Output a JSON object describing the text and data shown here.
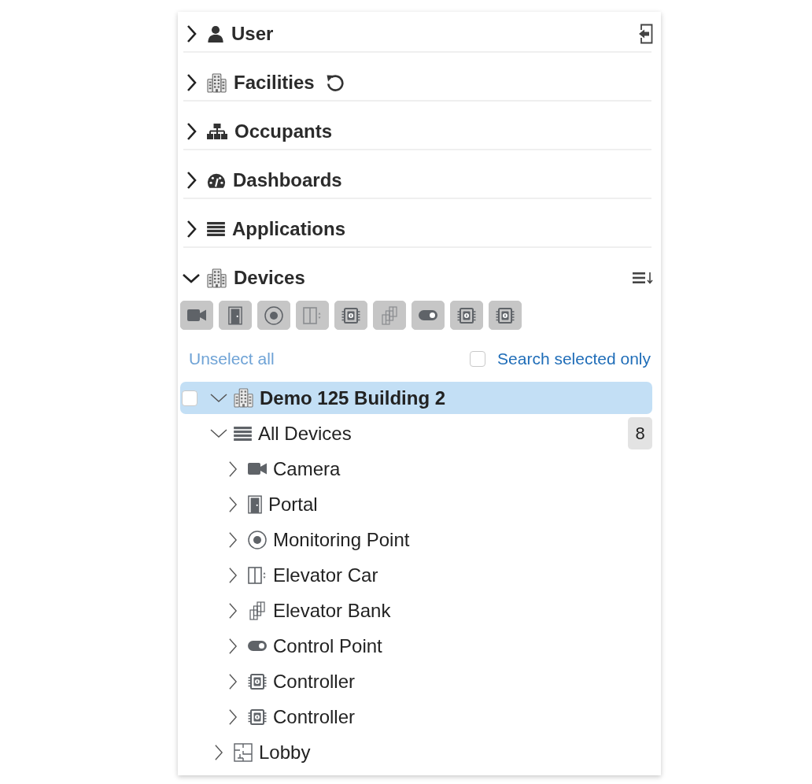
{
  "sections": [
    {
      "label": "User",
      "kind": "user",
      "expanded": false,
      "tool": {
        "kind": "exit"
      }
    },
    {
      "label": "Facilities",
      "kind": "building",
      "expanded": false,
      "tool": {
        "kind": "refresh"
      }
    },
    {
      "label": "Occupants",
      "kind": "org-chart",
      "expanded": false
    },
    {
      "label": "Dashboards",
      "kind": "gauge",
      "expanded": false
    },
    {
      "label": "Applications",
      "kind": "list",
      "expanded": false
    },
    {
      "label": "Devices",
      "kind": "building",
      "expanded": true,
      "tool": {
        "kind": "sort"
      },
      "filters": [
        {
          "kind": "camera",
          "selected": true
        },
        {
          "kind": "door",
          "selected": true
        },
        {
          "kind": "dot-circle",
          "selected": true
        },
        {
          "kind": "elevator-car",
          "selected": true
        },
        {
          "kind": "chip",
          "selected": true
        },
        {
          "kind": "elevator-bank",
          "selected": true
        },
        {
          "kind": "toggle",
          "selected": true
        },
        {
          "kind": "chip",
          "selected": true
        },
        {
          "kind": "chip",
          "selected": true
        }
      ],
      "unselect_link": "Unselect all",
      "search_selected_only": {
        "label": "Search selected only",
        "checked": false
      },
      "tree": [
        {
          "label": "Demo 125 Building 2",
          "kind": "building",
          "checked": false,
          "selected": true,
          "expanded": true,
          "children": [
            {
              "label": "All Devices",
              "kind": "list",
              "selected": false,
              "expanded": true,
              "count": "8",
              "children": [
                {
                  "label": "Camera",
                  "kind": "camera",
                  "selected": false,
                  "expanded": false
                },
                {
                  "label": "Portal",
                  "kind": "door",
                  "selected": false,
                  "expanded": false
                },
                {
                  "label": "Monitoring Point",
                  "kind": "dot-circle",
                  "selected": false,
                  "expanded": false
                },
                {
                  "label": "Elevator Car",
                  "kind": "elevator-car",
                  "selected": false,
                  "expanded": false
                },
                {
                  "label": "Elevator Bank",
                  "kind": "elevator-bank",
                  "selected": false,
                  "expanded": false
                },
                {
                  "label": "Control Point",
                  "kind": "toggle",
                  "selected": false,
                  "expanded": false
                },
                {
                  "label": "Controller",
                  "kind": "chip",
                  "selected": false,
                  "expanded": false
                },
                {
                  "label": "Controller",
                  "kind": "chip",
                  "selected": false,
                  "expanded": false
                }
              ]
            },
            {
              "label": "Lobby",
              "kind": "floor-plan",
              "selected": false,
              "expanded": false
            }
          ]
        }
      ]
    }
  ]
}
